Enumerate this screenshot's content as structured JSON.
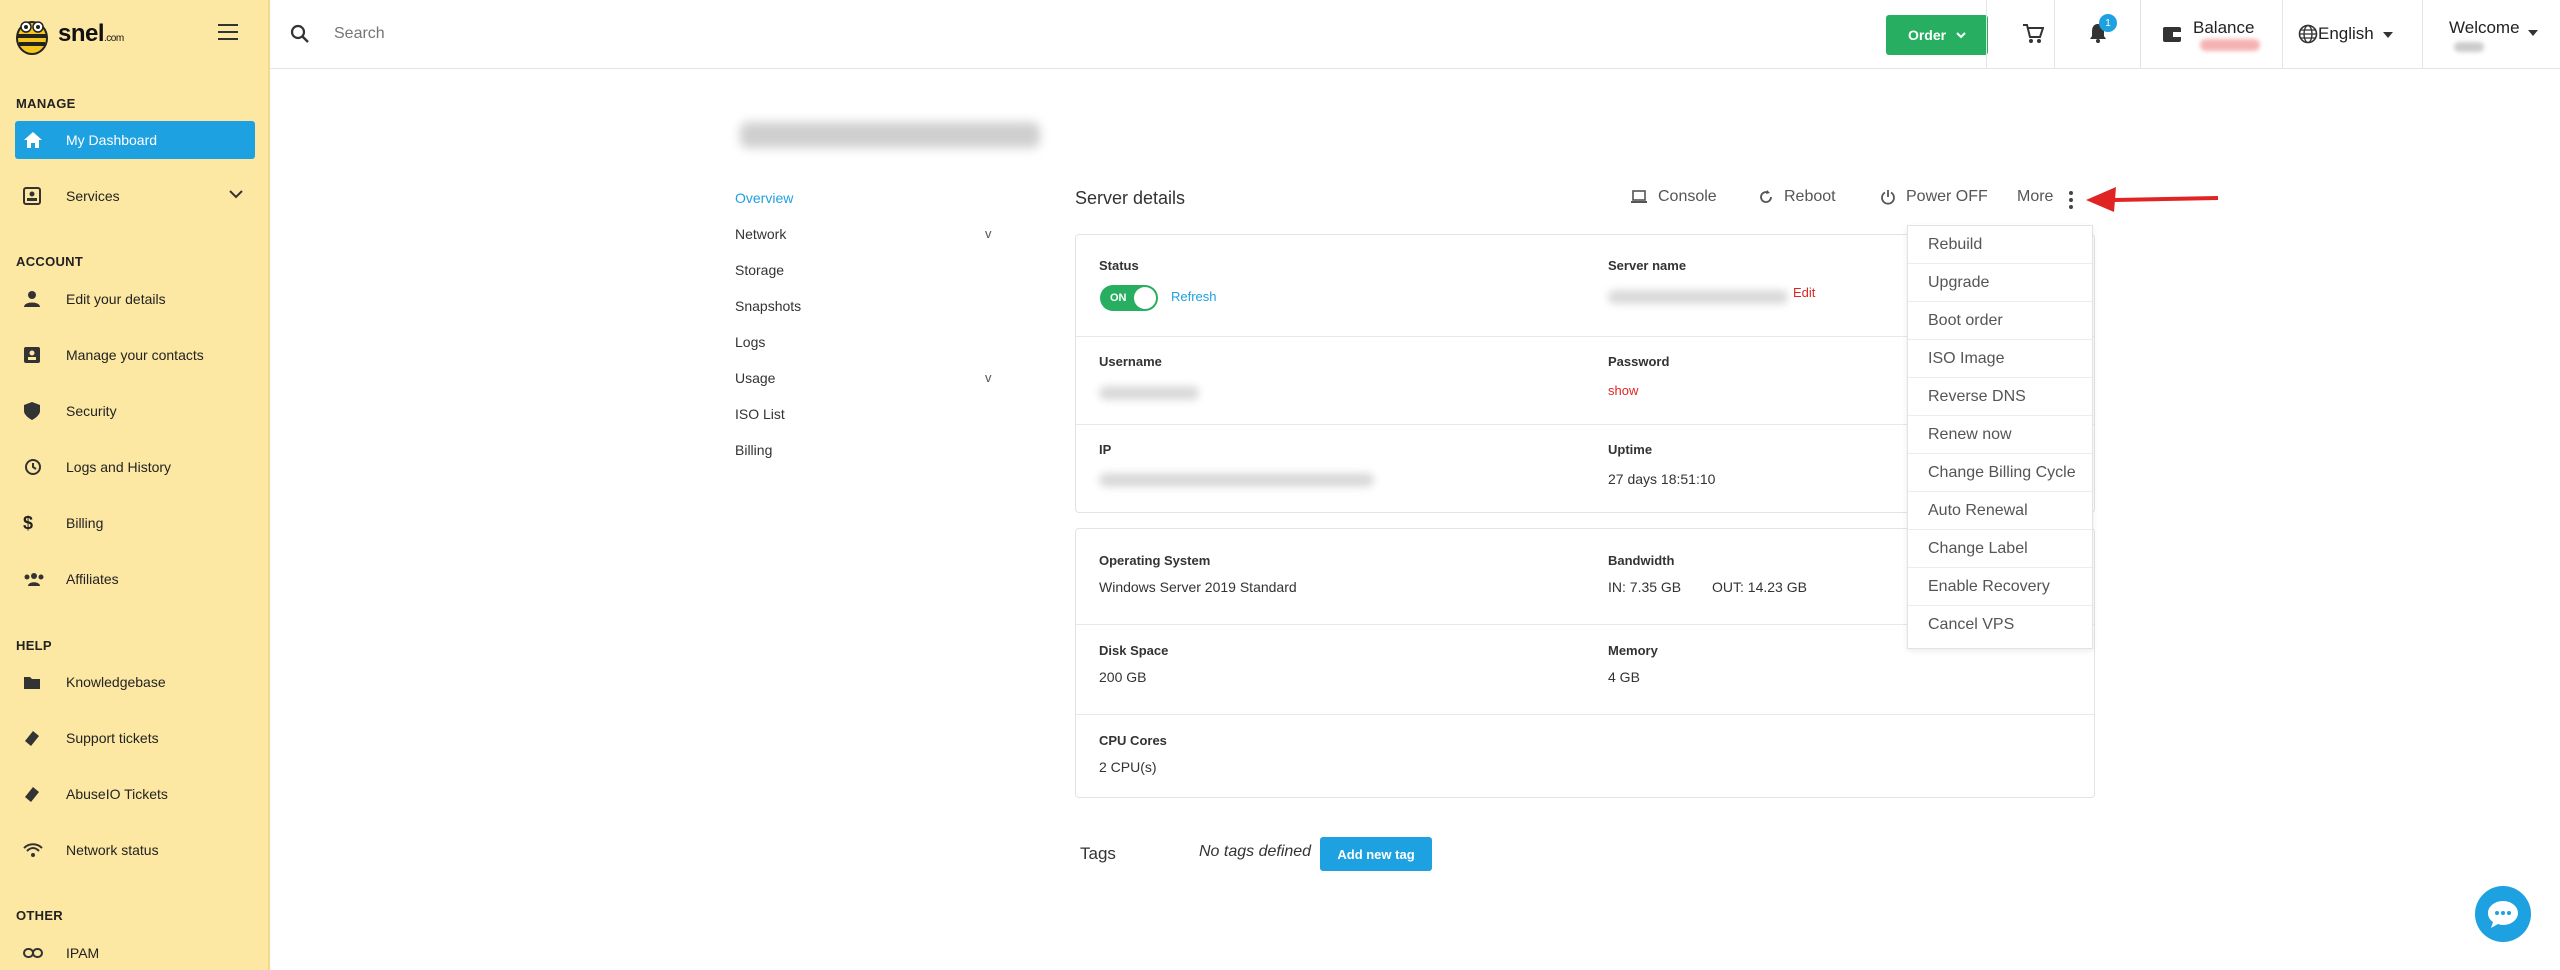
{
  "brand": {
    "name": "snel",
    "suffix": ".com"
  },
  "sidebar": {
    "sections": [
      {
        "title": "MANAGE"
      },
      {
        "title": "ACCOUNT"
      },
      {
        "title": "HELP"
      },
      {
        "title": "OTHER"
      }
    ],
    "items": [
      {
        "label": "My Dashboard",
        "icon": "home-icon"
      },
      {
        "label": "Services",
        "icon": "services-icon"
      },
      {
        "label": "Edit your details",
        "icon": "user-icon"
      },
      {
        "label": "Manage your contacts",
        "icon": "contacts-icon"
      },
      {
        "label": "Security",
        "icon": "shield-icon"
      },
      {
        "label": "Logs and History",
        "icon": "history-icon"
      },
      {
        "label": "Billing",
        "icon": "dollar-icon"
      },
      {
        "label": "Affiliates",
        "icon": "affiliates-icon"
      },
      {
        "label": "Knowledgebase",
        "icon": "folder-icon"
      },
      {
        "label": "Support tickets",
        "icon": "ticket-icon"
      },
      {
        "label": "AbuseIO Tickets",
        "icon": "ticket-icon"
      },
      {
        "label": "Network status",
        "icon": "wifi-icon"
      },
      {
        "label": "IPAM",
        "icon": "link-icon"
      }
    ]
  },
  "topbar": {
    "search_placeholder": "Search",
    "order_label": "Order",
    "notification_count": "1",
    "balance_label": "Balance",
    "language": "English",
    "welcome": "Welcome"
  },
  "subnav": {
    "items": [
      {
        "label": "Overview"
      },
      {
        "label": "Network"
      },
      {
        "label": "Storage"
      },
      {
        "label": "Snapshots"
      },
      {
        "label": "Logs"
      },
      {
        "label": "Usage"
      },
      {
        "label": "ISO List"
      },
      {
        "label": "Billing"
      }
    ],
    "expand_glyph": "v"
  },
  "server": {
    "title": "Server details",
    "actions": {
      "console": "Console",
      "reboot": "Reboot",
      "power_off": "Power OFF",
      "more": "More"
    },
    "status_label": "Status",
    "toggle_text": "ON",
    "refresh": "Refresh",
    "server_name_label": "Server name",
    "edit": "Edit",
    "username_label": "Username",
    "password_label": "Password",
    "password_show": "show",
    "ip_label": "IP",
    "uptime_label": "Uptime",
    "uptime_value": "27 days 18:51:10",
    "os_label": "Operating System",
    "os_value": "Windows Server 2019 Standard",
    "bandwidth_label": "Bandwidth",
    "bandwidth_in": "IN: 7.35 GB",
    "bandwidth_out": "OUT: 14.23 GB",
    "disk_label": "Disk Space",
    "disk_value": "200 GB",
    "memory_label": "Memory",
    "memory_value": "4 GB",
    "cpu_label": "CPU Cores",
    "cpu_value": "2 CPU(s)"
  },
  "more_menu": {
    "items": [
      "Rebuild",
      "Upgrade",
      "Boot order",
      "ISO Image",
      "Reverse DNS",
      "Renew now",
      "Change Billing Cycle",
      "Auto Renewal",
      "Change Label",
      "Enable Recovery",
      "Cancel VPS"
    ]
  },
  "tags": {
    "label": "Tags",
    "empty": "No tags defined",
    "add_button": "Add new tag"
  },
  "colors": {
    "sidebar_bg": "#fde8a3",
    "accent_blue": "#1ea1e0",
    "accent_green": "#27ae60",
    "danger_red": "#e02424"
  }
}
